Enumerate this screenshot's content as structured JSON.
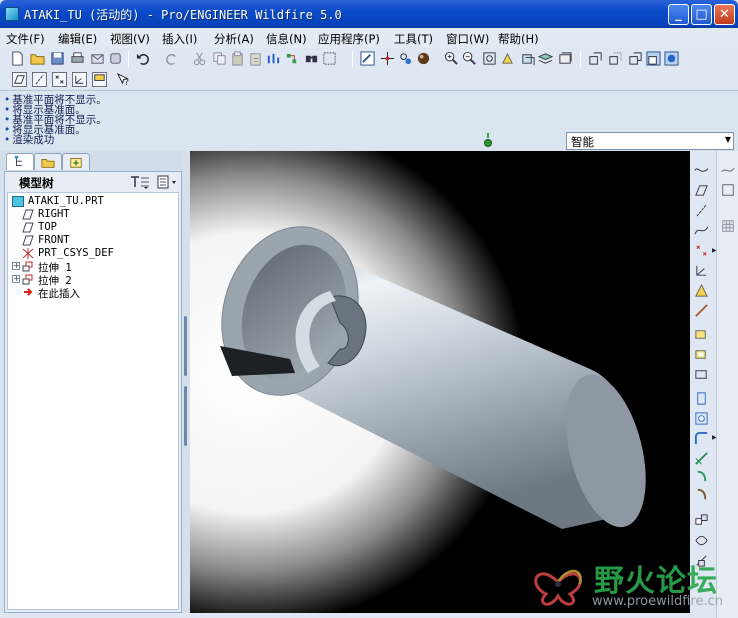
{
  "window": {
    "title": "ATAKI_TU (活动的) - Pro/ENGINEER Wildfire 5.0",
    "controls": [
      "minimize",
      "maximize",
      "close"
    ]
  },
  "menubar": {
    "items": [
      "文件(F)",
      "编辑(E)",
      "视图(V)",
      "插入(I)",
      "分析(A)",
      "信息(N)",
      "应用程序(P)",
      "工具(T)",
      "窗口(W)",
      "帮助(H)"
    ]
  },
  "toolbar": {
    "row1_icons": [
      "new-icon",
      "open-icon",
      "save-icon",
      "print-icon",
      "email-icon",
      "undo-icon",
      "redo-icon",
      "cut-icon",
      "copy-icon",
      "paste-icon",
      "paste-special-icon",
      "regenerate-icon",
      "regen-manager-icon",
      "find-icon",
      "select-box-icon",
      "repaint-icon",
      "spin-center-icon",
      "orient-icon",
      "display-style-icon",
      "zoom-in-icon",
      "zoom-out-icon",
      "refit-icon",
      "reorient-icon",
      "saved-views-icon",
      "layers-icon",
      "wireframe-icon",
      "hidden-line-icon",
      "no-hidden-icon",
      "shading-icon",
      "enhanced-realism-icon"
    ],
    "row2_icons": [
      "datum-plane-display-icon",
      "datum-axis-display-icon",
      "datum-point-display-icon",
      "csys-display-icon",
      "annotation-display-icon",
      "context-help-icon"
    ]
  },
  "messages": [
    "基准平面将不显示。",
    "将显示基准面。",
    "基准平面将不显示。",
    "将显示基准面。",
    "渲染成功"
  ],
  "filter": {
    "selected": "智能"
  },
  "navigator": {
    "tabs": [
      "model-tree-tab",
      "folder-browser-tab",
      "favorites-tab"
    ]
  },
  "model_tree": {
    "title": "模型树",
    "items": [
      {
        "label": "ATAKI_TU.PRT",
        "icon": "part-icon",
        "level": 0,
        "expandable": false
      },
      {
        "label": "RIGHT",
        "icon": "datum-plane-icon",
        "level": 1,
        "expandable": false
      },
      {
        "label": "TOP",
        "icon": "datum-plane-icon",
        "level": 1,
        "expandable": false
      },
      {
        "label": "FRONT",
        "icon": "datum-plane-icon",
        "level": 1,
        "expandable": false
      },
      {
        "label": "PRT_CSYS_DEF",
        "icon": "csys-icon",
        "level": 1,
        "expandable": false
      },
      {
        "label": "拉伸 1",
        "icon": "extrude-icon",
        "level": 1,
        "expandable": true
      },
      {
        "label": "拉伸 2",
        "icon": "extrude-icon",
        "level": 1,
        "expandable": true
      },
      {
        "label": "在此插入",
        "icon": "insert-here-icon",
        "level": 1,
        "expandable": false
      }
    ]
  },
  "right_toolbar": {
    "icons": [
      "sketch-curve-icon",
      "datum-plane-icon",
      "datum-axis-icon",
      "datum-curve-icon",
      "datum-point-icon",
      "datum-csys-icon",
      "analysis-feature-icon",
      "sketch-tool-icon",
      "placement-icon",
      "shell-icon",
      "rib-icon",
      "draft-icon",
      "hole-icon",
      "round-icon",
      "chamfer-icon",
      "extrude-tool-icon",
      "revolve-icon",
      "mirror-icon",
      "merge-icon"
    ]
  },
  "watermark": {
    "text": "野火论坛",
    "url": "www.proewildfire.cn"
  }
}
